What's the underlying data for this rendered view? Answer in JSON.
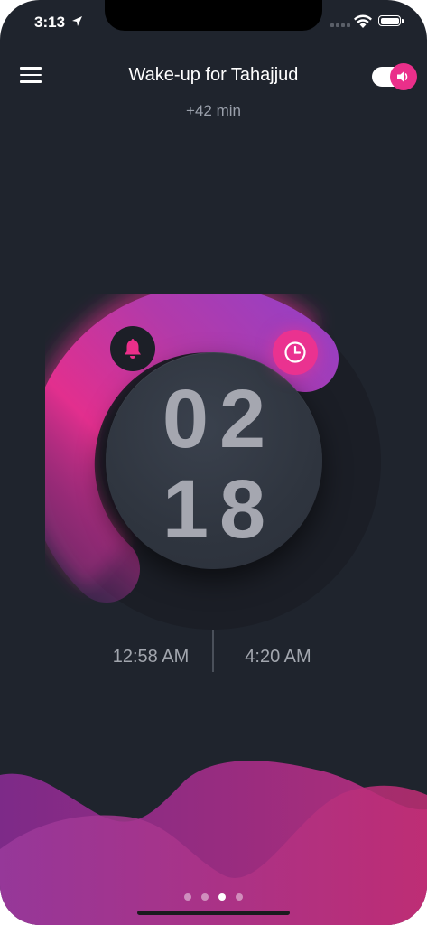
{
  "status_bar": {
    "time": "3:13"
  },
  "header": {
    "title": "Wake-up for Tahajjud",
    "subtitle": "+42 min"
  },
  "dial": {
    "hours": "02",
    "minutes": "18"
  },
  "times": {
    "start": "12:58 AM",
    "end": "4:20 AM"
  },
  "pager": {
    "pages": 4,
    "active_index": 2
  },
  "colors": {
    "background": "#1f242d",
    "accent_pink": "#ea2f8a",
    "accent_purple": "#9b3fc0",
    "text_muted": "#a2a6ae"
  },
  "icons": [
    "menu-icon",
    "speaker-icon",
    "bell-icon",
    "clock-icon",
    "wifi-icon",
    "battery-icon",
    "location-arrow-icon"
  ]
}
